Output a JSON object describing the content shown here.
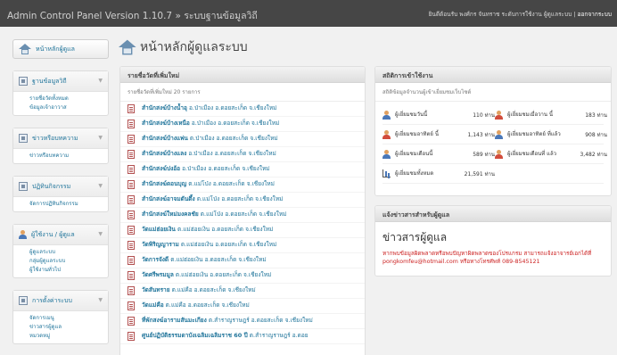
{
  "header": {
    "brand": "Admin Control Panel Version 1.10.7 » ระบบฐานข้อมูลวิถี",
    "user_text": "ยินดีต้อนรับ พงศ์กร จันทราช ระดับการใช้งาน ผู้ดูแลระบบ | ",
    "logout": "ออกจากระบบ"
  },
  "sidebar": {
    "home_label": "หน้าหลักผู้ดูแล",
    "groups": [
      {
        "title": "ฐานข้อมูลวิถี",
        "items": [
          "รายชื่อวัดทั้งหมด",
          "ข้อมูลเจ้าอาวาส"
        ]
      },
      {
        "title": "ข่าวหรือบทความ",
        "items": [
          "ข่าวหรือบทความ"
        ]
      },
      {
        "title": "ปฏิทินกิจกรรม",
        "items": [
          "จัดการปฏิทินกิจกรรม"
        ]
      },
      {
        "title": "ผู้ใช้งาน / ผู้ดูแล",
        "items": [
          "ผู้ดูแลระบบ",
          "กลุ่มผู้ดูแลระบบ",
          "ผู้ใช้งานทั่วไป"
        ]
      },
      {
        "title": "การตั้งค่าระบบ",
        "items": [
          "จัดการเมนู",
          "ข่าวสารผู้ดูแล",
          "หมวดหมู่"
        ]
      }
    ]
  },
  "page": {
    "title": "หน้าหลักผู้ดูแลระบบ"
  },
  "latest": {
    "title": "รายชื่อวัดที่เพิ่มใหม่",
    "subtitle": "รายชื่อวัดที่เพิ่มใหม่ 20 รายการ",
    "items": [
      {
        "name": "สำนักสงฆ์บ้างน้ำอุ",
        "place": " อ.ป่าเมือง อ.ดอยสะเก็ด จ.เชียงใหม่"
      },
      {
        "name": "สำนักสงฆ์บ้างเหนือ",
        "place": " อ.ป่าเมือง อ.ดอยสะเก็ด จ.เชียงใหม่"
      },
      {
        "name": "สำนักสงฆ์บ้างแพ่น",
        "place": " ต.ป่าเมือง อ.ดอยสะเก็ด จ.เชียงใหม่"
      },
      {
        "name": "สำนักสงฆ์บ้างแลง",
        "place": " อ.ป่าเมือง อ.ดอยสะเก็ด จ.เชียงใหม่"
      },
      {
        "name": "สำนักสงฆ์ปงอ้อ",
        "place": " อ.ป่าเมือง อ.ดอยสะเก็ด จ.เชียงใหม่"
      },
      {
        "name": "สำนักสงฆ์ดอนบุญ",
        "place": " ต.แม่โป่ง อ.ดอยสะเก็ด จ.เชียงใหม่"
      },
      {
        "name": "สำนักสงฆ์อาจมตันตึ้ง",
        "place": " ต.แม่โป่ง อ.ดอยสะเก็ด จ.เชียงใหม่"
      },
      {
        "name": "สำนักสงฆ์ใหม่มงคลชัย",
        "place": " ต.แม่โป่ง อ.ดอยสะเก็ด จ.เชียงใหม่"
      },
      {
        "name": "วัดแม่ฮ่อยเงิน",
        "place": " ต.แม่ฮ่อยเงิน อ.ดอยสะเก็ด จ.เชียงใหม่"
      },
      {
        "name": "วัดพิริญญาราม",
        "place": " ต.แม่ฮ่อยเงิน อ.ดอยสะเก็ด จ.เชียงใหม่"
      },
      {
        "name": "วัดการจังดี",
        "place": " ต.แม่ฮ่อยเงิน อ.ดอยสะเก็ด จ.เชียงใหม่"
      },
      {
        "name": "วัดศรีพรมมูล",
        "place": " ต.แม่ฮ่อยเงิน อ.ดอยสะเก็ด จ.เชียงใหม่"
      },
      {
        "name": "วัดสันทราย",
        "place": " ต.แม่คือ อ.ดอยสะเก็ด จ.เชียงใหม่"
      },
      {
        "name": "วัดแม่คือ",
        "place": " ต.แม่คือ อ.ดอยสะเก็ด จ.เชียงใหม่"
      },
      {
        "name": "ที่พักสงฆ์อารามสันมะเกียง",
        "place": " ต.สำราญราษฎร์ อ.ดอยสะเก็ด จ.เชียงใหม่"
      },
      {
        "name": "ศูนย์ปฏิบัติธรรมดาบังเฉลิมเฉลิมราช 60 ปี",
        "place": " ต.สำราญราษฎร์ อ.ดอย"
      }
    ]
  },
  "stats": {
    "title": "สถิติการเข้าใช้งาน",
    "subtitle": "สถิติข้อมูลจำนวนผู้เข้าเยี่ยมชมเว็บไซต์",
    "rows": [
      [
        {
          "label": "ผู้เยี่ยมชมวันนี้",
          "value": "110 ท่าน",
          "icon": "user-icon"
        },
        {
          "label": "ผู้เยี่ยมชมเมื่อวาน นี้",
          "value": "183 ท่าน",
          "icon": "user-icon"
        }
      ],
      [
        {
          "label": "ผู้เยี่ยมชมอาทิตย์ นี้",
          "value": "1,143 ท่าน",
          "icon": "user-icon"
        },
        {
          "label": "ผู้เยี่ยมชมอาทิตย์ ที่แล้ว",
          "value": "908 ท่าน",
          "icon": "user-icon"
        }
      ],
      [
        {
          "label": "ผู้เยี่ยมชมเดือนนี้",
          "value": "589 ท่าน",
          "icon": "user-icon"
        },
        {
          "label": "ผู้เยี่ยมชมเดือนที่ แล้ว",
          "value": "3,482 ท่าน",
          "icon": "user-icon"
        }
      ],
      [
        {
          "label": "ผู้เยี่ยมชมทั้งหมด",
          "value": "21,591 ท่าน",
          "icon": "chart-icon"
        }
      ]
    ]
  },
  "admin_news": {
    "title": "แจ้งข่าวสารสำหรับผู้ดูแล",
    "heading": "ข่าวสารผู้ดูแล",
    "body": "หากพบข้อมูลผิดพลาดหรือพบปัญหาผิดพลาดของโปรแกรม สามารถแจ้งอาจารย์เอกได้ที่ pongkomfeu@hotmail.com หรือทางโทรศัพท์ 089-8545121"
  }
}
